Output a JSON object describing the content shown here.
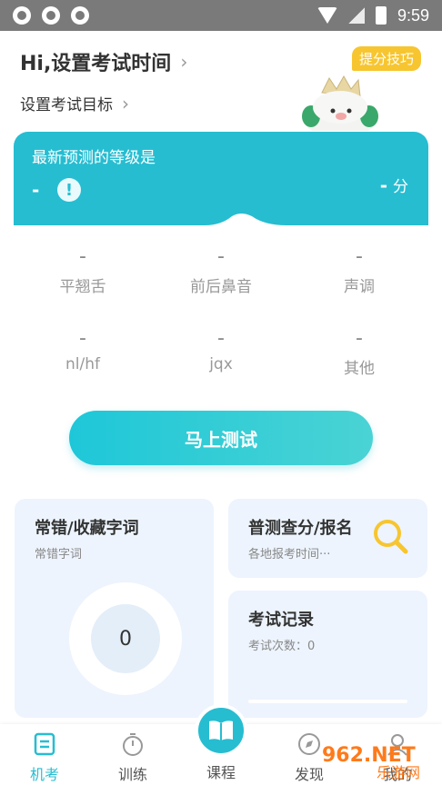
{
  "status_bar": {
    "time": "9:59"
  },
  "header": {
    "title": "Hi,设置考试时间",
    "target": "设置考试目标",
    "tip_badge": "提分技巧"
  },
  "prediction": {
    "title": "最新预测的等级是",
    "level": "-",
    "score": "-",
    "score_unit": "分"
  },
  "metrics": [
    {
      "value": "-",
      "label": "平翘舌"
    },
    {
      "value": "-",
      "label": "前后鼻音"
    },
    {
      "value": "-",
      "label": "声调"
    },
    {
      "value": "-",
      "label": "nl/hf"
    },
    {
      "value": "-",
      "label": "jqx"
    },
    {
      "value": "-",
      "label": "其他"
    }
  ],
  "test_button": "马上测试",
  "cards": {
    "mistakes": {
      "title": "常错/收藏字词",
      "subtitle": "常错字词",
      "count": "0"
    },
    "registration": {
      "title": "普测查分/报名",
      "subtitle": "各地报考时间···"
    },
    "records": {
      "title": "考试记录",
      "subtitle": "考试次数：0"
    }
  },
  "nav": [
    {
      "label": "机考",
      "icon": "document-icon"
    },
    {
      "label": "训练",
      "icon": "stopwatch-icon"
    },
    {
      "label": "课程",
      "icon": "book-icon"
    },
    {
      "label": "发现",
      "icon": "compass-icon"
    },
    {
      "label": "我的",
      "icon": "person-icon"
    }
  ],
  "watermark": {
    "line1": "962.NET",
    "line2": "乐游网"
  },
  "colors": {
    "accent": "#26bdd1",
    "badge": "#f7c52f",
    "card_bg": "#edf4fd"
  }
}
